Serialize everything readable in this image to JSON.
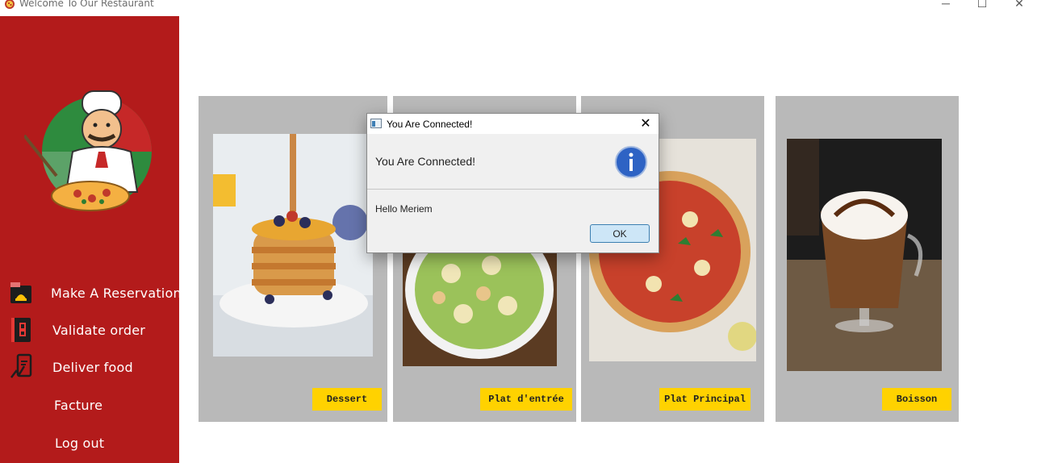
{
  "window": {
    "title": "Welcome To Our Restaurant",
    "app_icon": "pizza-icon",
    "controls": {
      "minimize": "─",
      "maximize": "☐",
      "close": "✕"
    }
  },
  "sidebar": {
    "background": "#b31b1b",
    "logo": "chef-logo",
    "items": [
      {
        "label": "Make A Reservation",
        "icon": "reservation-icon"
      },
      {
        "label": "Validate order",
        "icon": "order-book-icon"
      },
      {
        "label": "Deliver food",
        "icon": "delivery-phone-icon"
      },
      {
        "label": "Facture",
        "icon": ""
      },
      {
        "label": "Log out",
        "icon": ""
      }
    ]
  },
  "categories": [
    {
      "label": "Dessert",
      "image": "pancakes-photo"
    },
    {
      "label": "Plat d'entrée",
      "image": "pasta-salad-photo"
    },
    {
      "label": "Plat Principal",
      "image": "pizza-photo"
    },
    {
      "label": "Boisson",
      "image": "coffee-drink-photo"
    }
  ],
  "colors": {
    "card": "#b9b9b9",
    "button": "#ffd200",
    "accent": "#b31b1b"
  },
  "dialog": {
    "title": "You Are Connected!",
    "header": "You Are Connected!",
    "message": "Hello Meriem",
    "ok_label": "OK",
    "icon": "info-icon",
    "close_glyph": "✕"
  }
}
